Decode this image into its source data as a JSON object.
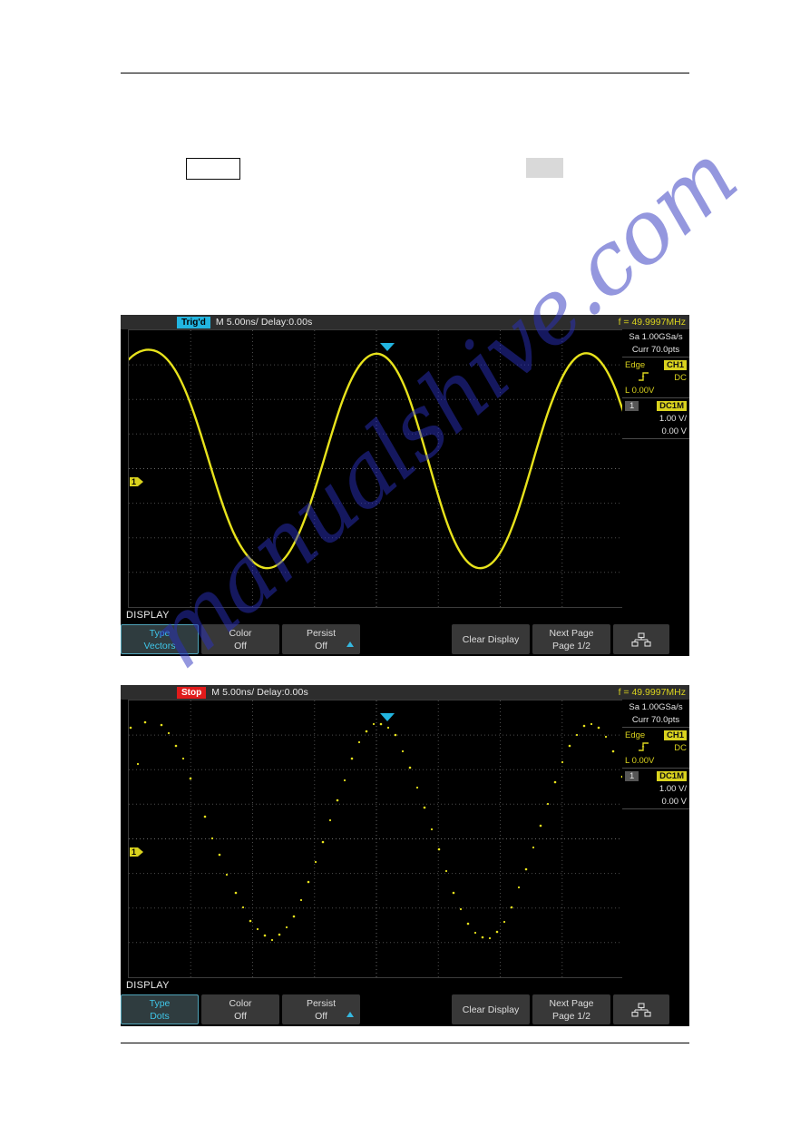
{
  "page": {
    "watermark": "manualshive.com"
  },
  "placeholders": {
    "outline_box": "",
    "filled_box": ""
  },
  "scopes": [
    {
      "id": "vectors-screenshot",
      "statusbar": {
        "trigger_state": "Trig'd",
        "trigger_state_color": "#22b5e0",
        "timebase": "M 5.00ns/  Delay:0.00s",
        "frequency": "f = 49.9997MHz"
      },
      "sidebar": {
        "sample_rate": "Sa 1.00GSa/s",
        "memory_depth": "Curr 70.0pts",
        "trigger_type": "Edge",
        "trigger_source": "CH1",
        "trigger_slope_icon": "rising-edge-icon",
        "trigger_coupling": "DC",
        "trigger_level": "L  0.00V",
        "channel_number": "1",
        "channel_impedance": "DC1M",
        "volts_per_div": "1.00 V/",
        "offset": "0.00 V"
      },
      "markers": {
        "channel_tag": "1",
        "trigger_position_icon": "trigger-position-marker",
        "trigger_level_icon": "trigger-level-marker"
      },
      "menu": {
        "title": "DISPLAY",
        "keys": [
          {
            "name": "type",
            "line1": "Type",
            "line2": "Vectors",
            "selected": true,
            "arrow": false
          },
          {
            "name": "color",
            "line1": "Color",
            "line2": "Off",
            "selected": false,
            "arrow": false
          },
          {
            "name": "persist",
            "line1": "Persist",
            "line2": "Off",
            "selected": false,
            "arrow": true
          },
          {
            "name": "clear-display",
            "line1": "Clear Display",
            "line2": "",
            "selected": false,
            "arrow": false
          },
          {
            "name": "next-page",
            "line1": "Next Page",
            "line2": "Page 1/2",
            "selected": false,
            "arrow": false
          }
        ],
        "network_icon": "network-tree-icon"
      },
      "waveform": {
        "mode": "vectors",
        "color": "#e8e31c"
      }
    },
    {
      "id": "dots-screenshot",
      "statusbar": {
        "trigger_state": "Stop",
        "trigger_state_color": "#e01b1b",
        "timebase": "M 5.00ns/  Delay:0.00s",
        "frequency": "f = 49.9997MHz"
      },
      "sidebar": {
        "sample_rate": "Sa 1.00GSa/s",
        "memory_depth": "Curr 70.0pts",
        "trigger_type": "Edge",
        "trigger_source": "CH1",
        "trigger_slope_icon": "rising-edge-icon",
        "trigger_coupling": "DC",
        "trigger_level": "L  0.00V",
        "channel_number": "1",
        "channel_impedance": "DC1M",
        "volts_per_div": "1.00 V/",
        "offset": "0.00 V"
      },
      "markers": {
        "channel_tag": "1",
        "trigger_position_icon": "trigger-position-marker",
        "trigger_level_icon": "trigger-level-marker"
      },
      "menu": {
        "title": "DISPLAY",
        "keys": [
          {
            "name": "type",
            "line1": "Type",
            "line2": "Dots",
            "selected": true,
            "arrow": false
          },
          {
            "name": "color",
            "line1": "Color",
            "line2": "Off",
            "selected": false,
            "arrow": false
          },
          {
            "name": "persist",
            "line1": "Persist",
            "line2": "Off",
            "selected": false,
            "arrow": true
          },
          {
            "name": "clear-display",
            "line1": "Clear Display",
            "line2": "",
            "selected": false,
            "arrow": false
          },
          {
            "name": "next-page",
            "line1": "Next Page",
            "line2": "Page 1/2",
            "selected": false,
            "arrow": false
          }
        ],
        "network_icon": "network-tree-icon"
      },
      "waveform": {
        "mode": "dots",
        "color": "#e8e31c"
      }
    }
  ]
}
